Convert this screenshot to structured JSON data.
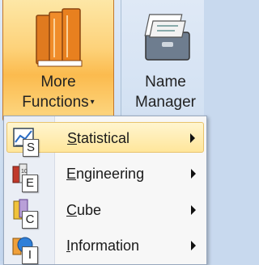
{
  "ribbon": {
    "more_functions": {
      "line1": "More",
      "line2": "Functions",
      "arrow": "▾",
      "icon": "books-icon"
    },
    "name_manager": {
      "line1": "Name",
      "line2": "Manager",
      "icon": "card-file-icon"
    }
  },
  "menu": {
    "items": [
      {
        "mnemonic": "S",
        "first": "S",
        "rest": "tatistical",
        "icon": "statistical-chart-icon",
        "key": "S"
      },
      {
        "mnemonic": "E",
        "first": "E",
        "rest": "ngineering",
        "icon": "engineering-icon",
        "key": "E"
      },
      {
        "mnemonic": "C",
        "first": "C",
        "rest": "ube",
        "icon": "cube-icon",
        "key": "C"
      },
      {
        "mnemonic": "I",
        "first": "I",
        "rest": "nformation",
        "icon": "information-icon",
        "key": "I"
      }
    ]
  },
  "colors": {
    "highlight": "#fbbb4e",
    "menu_selected": "#ffe69b",
    "ribbon_text": "#15428b"
  }
}
